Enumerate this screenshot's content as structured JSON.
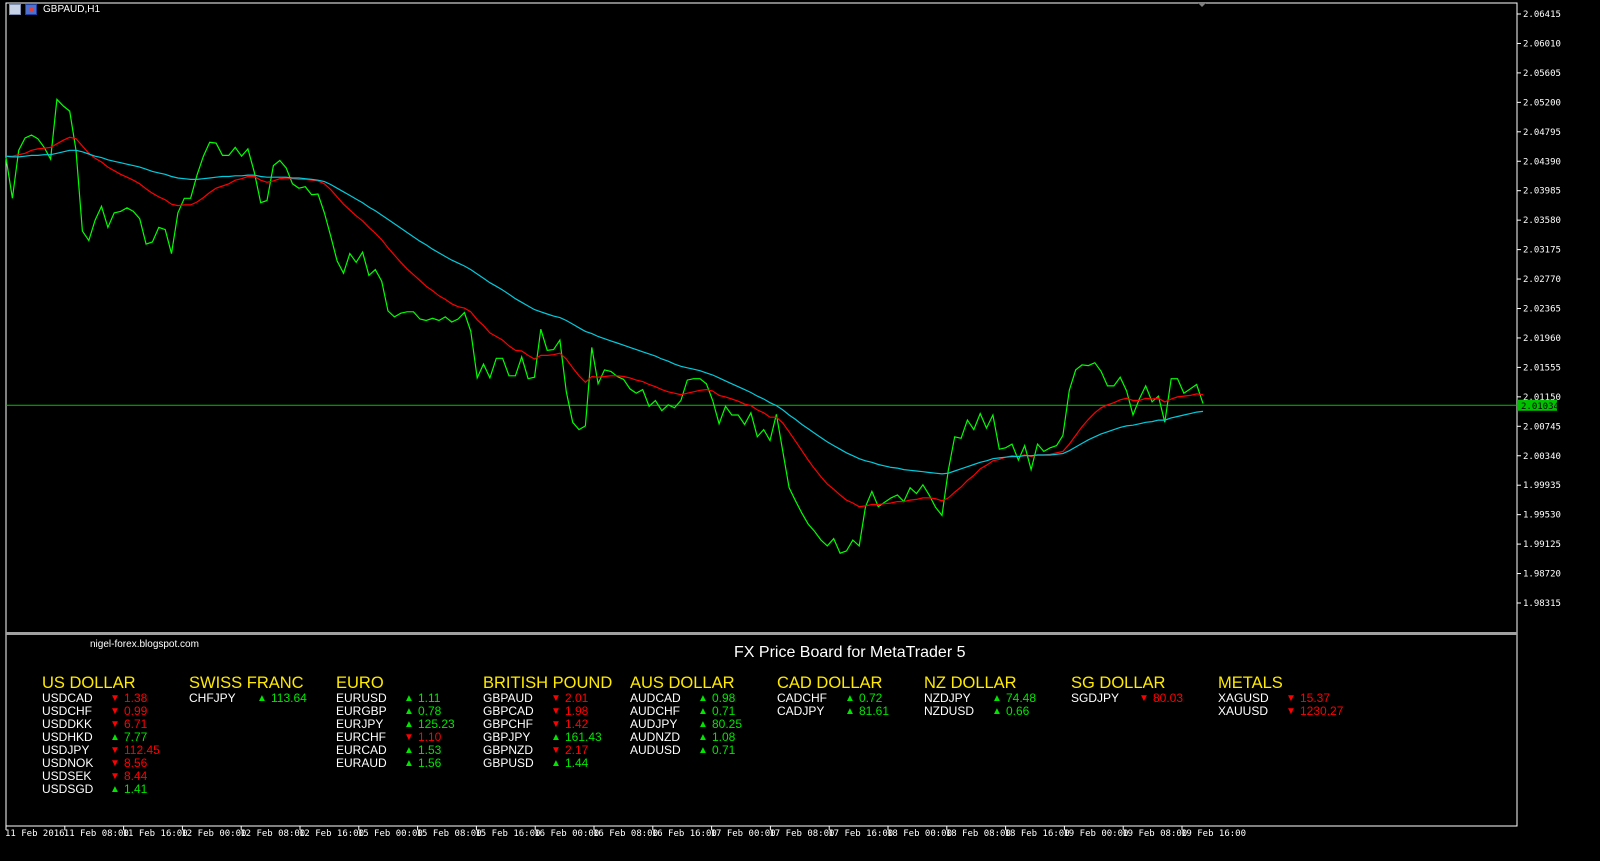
{
  "window": {
    "title": "GBPAUD,H1"
  },
  "chart_data": {
    "type": "line",
    "symbol": "GBPAUD",
    "timeframe": "H1",
    "current_price": "2.01034",
    "ylim": [
      1.98315,
      2.06415
    ],
    "y_ticks": [
      "2.06415",
      "2.06010",
      "2.05605",
      "2.05200",
      "2.04795",
      "2.04390",
      "2.03985",
      "2.03580",
      "2.03175",
      "2.02770",
      "2.02365",
      "2.01960",
      "2.01555",
      "2.01150",
      "2.00745",
      "2.00340",
      "1.99935",
      "1.99530",
      "1.99125",
      "1.98720",
      "1.98315"
    ],
    "x_ticks": [
      "11 Feb 2016",
      "11 Feb 08:00",
      "11 Feb 16:00",
      "12 Feb 00:00",
      "12 Feb 08:00",
      "12 Feb 16:00",
      "15 Feb 00:00",
      "15 Feb 08:00",
      "15 Feb 16:00",
      "16 Feb 00:00",
      "16 Feb 08:00",
      "16 Feb 16:00",
      "17 Feb 00:00",
      "17 Feb 08:00",
      "17 Feb 16:00",
      "18 Feb 00:00",
      "18 Feb 08:00",
      "18 Feb 16:00",
      "19 Feb 00:00",
      "19 Feb 08:00",
      "19 Feb 16:00"
    ],
    "series": [
      {
        "color": "#00ff00",
        "values": [
          2.0444,
          2.0388,
          2.0454,
          2.0471,
          2.0475,
          2.047,
          2.0458,
          2.0442,
          2.0524,
          2.0515,
          2.0508,
          2.0454,
          2.0343,
          2.033,
          2.0358,
          2.0377,
          2.0348,
          2.0368,
          2.037,
          2.0375,
          2.037,
          2.036,
          2.0325,
          2.0328,
          2.0348,
          2.0345,
          2.0312,
          2.0368,
          2.0388,
          2.0388,
          2.042,
          2.0446,
          2.0465,
          2.0464,
          2.0447,
          2.0447,
          2.0458,
          2.0446,
          2.0456,
          2.0424,
          2.0382,
          2.0385,
          2.0433,
          2.044,
          2.043,
          2.0408,
          2.0402,
          2.0404,
          2.0393,
          2.0394,
          2.0368,
          2.0336,
          2.0302,
          2.0285,
          2.0312,
          2.03,
          2.0314,
          2.0282,
          2.029,
          2.0274,
          2.0233,
          2.0225,
          2.023,
          2.0232,
          2.0232,
          2.0222,
          2.022,
          2.0223,
          2.022,
          2.0225,
          2.0218,
          2.0222,
          2.0231,
          2.0205,
          2.0141,
          2.016,
          2.0141,
          2.0168,
          2.0168,
          2.0144,
          2.0144,
          2.017,
          2.014,
          2.0142,
          2.0208,
          2.0179,
          2.018,
          2.0193,
          2.0122,
          2.008,
          2.007,
          2.0075,
          2.0183,
          2.0133,
          2.0152,
          2.015,
          2.0143,
          2.0139,
          2.0126,
          2.012,
          2.0125,
          2.0102,
          2.011,
          2.0096,
          2.0104,
          2.01,
          2.011,
          2.0138,
          2.014,
          2.014,
          2.0133,
          2.011,
          2.0078,
          2.0102,
          2.009,
          2.009,
          2.0077,
          2.0093,
          2.006,
          2.007,
          2.0055,
          2.0091,
          2.004,
          1.999,
          1.9972,
          1.9955,
          1.994,
          1.993,
          1.9918,
          1.991,
          1.992,
          1.99,
          1.9903,
          1.9918,
          1.991,
          1.9964,
          1.9985,
          1.9964,
          1.997,
          1.9976,
          1.998,
          1.9971,
          1.999,
          1.9982,
          1.9994,
          1.998,
          1.9963,
          1.9952,
          2.0014,
          2.006,
          2.0058,
          2.0083,
          2.007,
          2.0092,
          2.0072,
          2.009,
          2.0043,
          2.0045,
          2.005,
          2.0028,
          2.0048,
          2.0015,
          2.005,
          2.004,
          2.0045,
          2.0048,
          2.0062,
          2.0124,
          2.0152,
          2.0159,
          2.0158,
          2.0162,
          2.015,
          2.013,
          2.013,
          2.0142,
          2.0123,
          2.009,
          2.0112,
          2.013,
          2.0108,
          2.0116,
          2.008,
          2.014,
          2.014,
          2.012,
          2.0126,
          2.0132,
          2.0106
        ]
      },
      {
        "color": "#ff0000",
        "values": [
          2.0446,
          2.0446,
          2.0448,
          2.045,
          2.0454,
          2.0456,
          2.0457,
          2.0458,
          2.0463,
          2.0468,
          2.0472,
          2.047,
          2.046,
          2.045,
          2.0443,
          2.0438,
          2.0431,
          2.0426,
          2.0421,
          2.0417,
          2.0413,
          2.0408,
          2.0401,
          2.0395,
          2.039,
          2.0386,
          2.038,
          2.0378,
          2.0379,
          2.0379,
          2.0383,
          2.0389,
          2.0396,
          2.0402,
          2.0405,
          2.0408,
          2.0413,
          2.0415,
          2.0418,
          2.0418,
          2.0413,
          2.041,
          2.0412,
          2.0415,
          2.0416,
          2.0415,
          2.0414,
          2.0414,
          2.0413,
          2.0412,
          2.0408,
          2.04,
          2.039,
          2.038,
          2.0372,
          2.0364,
          2.0357,
          2.0348,
          2.034,
          2.0331,
          2.032,
          2.031,
          2.03,
          2.0291,
          2.0283,
          2.0275,
          2.0267,
          2.0261,
          2.0254,
          2.0249,
          2.0243,
          2.0239,
          2.0237,
          2.0232,
          2.0221,
          2.0213,
          2.0203,
          2.0198,
          2.0193,
          2.0185,
          2.0179,
          2.0178,
          2.0172,
          2.0167,
          2.0172,
          2.0172,
          2.0173,
          2.0175,
          2.0167,
          2.0155,
          2.0144,
          2.0135,
          2.0143,
          2.0142,
          2.0143,
          2.0144,
          2.0144,
          2.0143,
          2.0141,
          2.0138,
          2.0136,
          2.0132,
          2.0129,
          2.0125,
          2.0122,
          2.012,
          2.0118,
          2.012,
          2.0122,
          2.0124,
          2.0125,
          2.0123,
          2.0117,
          2.0115,
          2.0112,
          2.0109,
          2.0105,
          2.0103,
          2.0097,
          2.0093,
          2.0087,
          2.0087,
          2.0079,
          2.0067,
          2.0054,
          2.0041,
          2.0028,
          2.0016,
          2.0005,
          1.9995,
          1.9988,
          1.998,
          1.9973,
          1.9969,
          1.9964,
          1.9965,
          1.9967,
          1.9967,
          1.9968,
          1.9969,
          1.9971,
          1.9971,
          1.9973,
          1.9974,
          1.9976,
          1.9976,
          1.9975,
          1.9972,
          1.9976,
          1.9984,
          1.9991,
          2.0,
          2.0007,
          2.0016,
          2.0021,
          2.0027,
          2.0029,
          2.0032,
          2.0034,
          2.0033,
          2.0035,
          2.0033,
          2.0035,
          2.0035,
          2.0036,
          2.0038,
          2.004,
          2.005,
          2.0062,
          2.0074,
          2.0084,
          2.0093,
          2.01,
          2.0104,
          2.0107,
          2.0111,
          2.0113,
          2.011,
          2.011,
          2.0113,
          2.0112,
          2.0113,
          2.0108,
          2.0112,
          2.0115,
          2.0116,
          2.0117,
          2.0119,
          2.0118
        ]
      },
      {
        "color": "#00ccdd",
        "values": [
          2.0446,
          2.0445,
          2.0445,
          2.0446,
          2.0447,
          2.0447,
          2.0448,
          2.0448,
          2.045,
          2.0452,
          2.0454,
          2.0454,
          2.0452,
          2.0449,
          2.0446,
          2.0444,
          2.0441,
          2.0439,
          2.0437,
          2.0435,
          2.0433,
          2.0431,
          2.0428,
          2.0425,
          2.0423,
          2.0421,
          2.0418,
          2.0416,
          2.0415,
          2.0414,
          2.0414,
          2.0415,
          2.0416,
          2.0417,
          2.0418,
          2.0418,
          2.0419,
          2.0419,
          2.042,
          2.042,
          2.0418,
          2.0417,
          2.0417,
          2.0417,
          2.0417,
          2.0416,
          2.0416,
          2.0415,
          2.0414,
          2.0413,
          2.0411,
          2.0407,
          2.0402,
          2.0397,
          2.0392,
          2.0387,
          2.0382,
          2.0376,
          2.0371,
          2.0365,
          2.0359,
          2.0353,
          2.0347,
          2.0341,
          2.0335,
          2.0329,
          2.0324,
          2.0318,
          2.0313,
          2.0308,
          2.0303,
          2.0299,
          2.0295,
          2.029,
          2.0284,
          2.0278,
          2.0272,
          2.0267,
          2.0262,
          2.0256,
          2.025,
          2.0245,
          2.024,
          2.0235,
          2.0232,
          2.0229,
          2.0226,
          2.0224,
          2.022,
          2.0215,
          2.021,
          2.0205,
          2.0202,
          2.0198,
          2.0195,
          2.0192,
          2.0189,
          2.0186,
          2.0183,
          2.018,
          2.0177,
          2.0174,
          2.0171,
          2.0167,
          2.0164,
          2.016,
          2.0157,
          2.0155,
          2.0153,
          2.0151,
          2.0148,
          2.0145,
          2.0141,
          2.0137,
          2.0133,
          2.0129,
          2.0125,
          2.0121,
          2.0116,
          2.0112,
          2.0107,
          2.0103,
          2.0097,
          2.009,
          2.0084,
          2.0077,
          2.0071,
          2.0065,
          2.0059,
          2.0053,
          2.0048,
          2.0043,
          2.0038,
          2.0034,
          2.003,
          2.0027,
          2.0025,
          2.0022,
          2.002,
          2.0018,
          2.0017,
          2.0015,
          2.0014,
          2.0013,
          2.0012,
          2.0011,
          2.001,
          2.0009,
          2.001,
          2.0013,
          2.0016,
          2.0019,
          2.0022,
          2.0025,
          2.0027,
          2.003,
          2.0031,
          2.0032,
          2.0033,
          2.0033,
          2.0034,
          2.0034,
          2.0035,
          2.0035,
          2.0035,
          2.0036,
          2.0037,
          2.0041,
          2.0046,
          2.0051,
          2.0056,
          2.006,
          2.0064,
          2.0067,
          2.007,
          2.0073,
          2.0075,
          2.0076,
          2.0078,
          2.008,
          2.0081,
          2.0083,
          2.0083,
          2.0086,
          2.0088,
          2.009,
          2.0092,
          2.0094,
          2.0095
        ]
      }
    ]
  },
  "board": {
    "site": "nigel-forex.blogspot.com",
    "title": "FX Price Board for MetaTrader 5",
    "colors": {
      "heading": "#ffea00",
      "up": "#00e600",
      "down": "#ff0000"
    },
    "groups": [
      {
        "name": "US DOLLAR",
        "rows": [
          {
            "symbol": "USDCAD",
            "dir": "down",
            "value": "1.38"
          },
          {
            "symbol": "USDCHF",
            "dir": "down",
            "value": "0.99"
          },
          {
            "symbol": "USDDKK",
            "dir": "down",
            "value": "6.71"
          },
          {
            "symbol": "USDHKD",
            "dir": "up",
            "value": "7.77"
          },
          {
            "symbol": "USDJPY",
            "dir": "down",
            "value": "112.45"
          },
          {
            "symbol": "USDNOK",
            "dir": "down",
            "value": "8.56"
          },
          {
            "symbol": "USDSEK",
            "dir": "down",
            "value": "8.44"
          },
          {
            "symbol": "USDSGD",
            "dir": "up",
            "value": "1.41"
          }
        ]
      },
      {
        "name": "SWISS FRANC",
        "rows": [
          {
            "symbol": "CHFJPY",
            "dir": "up",
            "value": "113.64"
          }
        ]
      },
      {
        "name": "EURO",
        "rows": [
          {
            "symbol": "EURUSD",
            "dir": "up",
            "value": "1.11"
          },
          {
            "symbol": "EURGBP",
            "dir": "up",
            "value": "0.78"
          },
          {
            "symbol": "EURJPY",
            "dir": "up",
            "value": "125.23"
          },
          {
            "symbol": "EURCHF",
            "dir": "down",
            "value": "1.10"
          },
          {
            "symbol": "EURCAD",
            "dir": "up",
            "value": "1.53"
          },
          {
            "symbol": "EURAUD",
            "dir": "up",
            "value": "1.56"
          }
        ]
      },
      {
        "name": "BRITISH POUND",
        "rows": [
          {
            "symbol": "GBPAUD",
            "dir": "down",
            "value": "2.01"
          },
          {
            "symbol": "GBPCAD",
            "dir": "down",
            "value": "1.98"
          },
          {
            "symbol": "GBPCHF",
            "dir": "down",
            "value": "1.42"
          },
          {
            "symbol": "GBPJPY",
            "dir": "up",
            "value": "161.43"
          },
          {
            "symbol": "GBPNZD",
            "dir": "down",
            "value": "2.17"
          },
          {
            "symbol": "GBPUSD",
            "dir": "up",
            "value": "1.44"
          }
        ]
      },
      {
        "name": "AUS DOLLAR",
        "rows": [
          {
            "symbol": "AUDCAD",
            "dir": "up",
            "value": "0.98"
          },
          {
            "symbol": "AUDCHF",
            "dir": "up",
            "value": "0.71"
          },
          {
            "symbol": "AUDJPY",
            "dir": "up",
            "value": "80.25"
          },
          {
            "symbol": "AUDNZD",
            "dir": "up",
            "value": "1.08"
          },
          {
            "symbol": "AUDUSD",
            "dir": "up",
            "value": "0.71"
          }
        ]
      },
      {
        "name": "CAD DOLLAR",
        "rows": [
          {
            "symbol": "CADCHF",
            "dir": "up",
            "value": "0.72"
          },
          {
            "symbol": "CADJPY",
            "dir": "up",
            "value": "81.61"
          }
        ]
      },
      {
        "name": "NZ DOLLAR",
        "rows": [
          {
            "symbol": "NZDJPY",
            "dir": "up",
            "value": "74.48"
          },
          {
            "symbol": "NZDUSD",
            "dir": "up",
            "value": "0.66"
          }
        ]
      },
      {
        "name": "SG DOLLAR",
        "rows": [
          {
            "symbol": "SGDJPY",
            "dir": "down",
            "value": "80.03"
          }
        ]
      },
      {
        "name": "METALS",
        "rows": [
          {
            "symbol": "XAGUSD",
            "dir": "down",
            "value": "15.37"
          },
          {
            "symbol": "XAUUSD",
            "dir": "down",
            "value": "1230.27"
          }
        ]
      }
    ]
  }
}
